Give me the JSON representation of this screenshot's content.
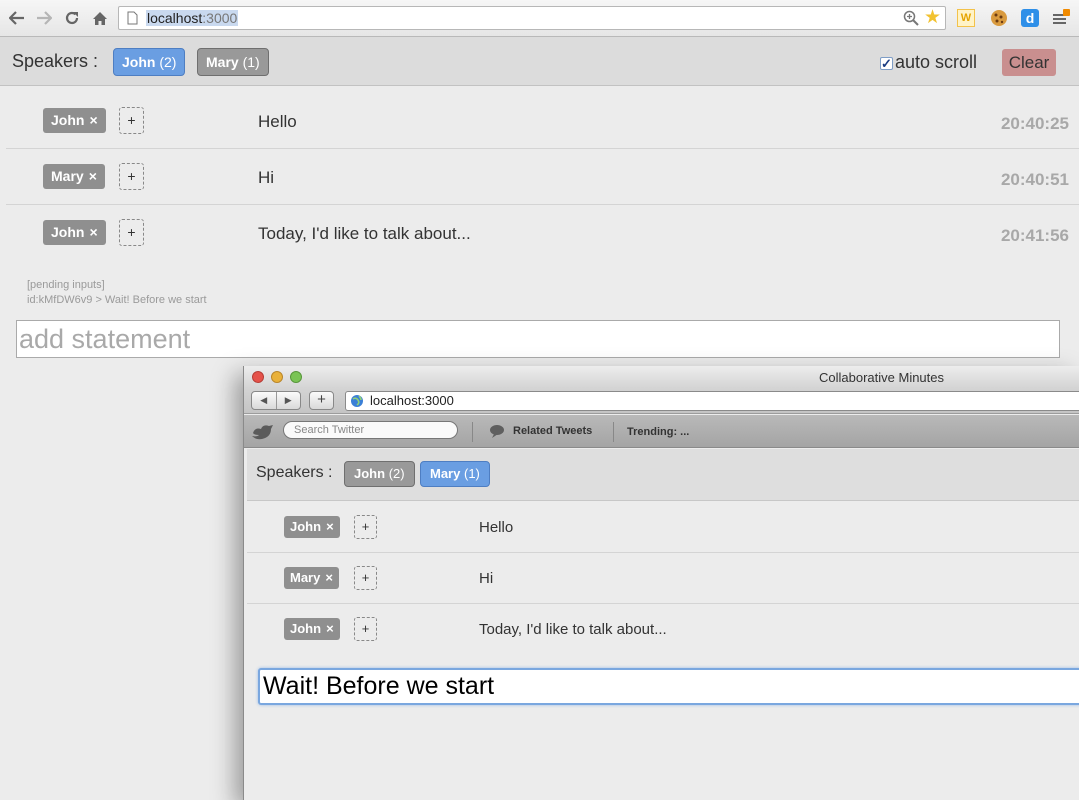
{
  "browser": {
    "url_host": "localhost",
    "url_port": ":3000"
  },
  "app": {
    "speakers_label": "Speakers :",
    "speakers": [
      {
        "name": "John",
        "count": "(2)",
        "active": true
      },
      {
        "name": "Mary",
        "count": "(1)",
        "active": false
      }
    ],
    "auto_scroll_label": "auto scroll",
    "auto_scroll_checked": true,
    "clear_label": "Clear",
    "statements": [
      {
        "speaker": "John",
        "remove": "×",
        "add": "+",
        "text": "Hello",
        "time": "20:40:25"
      },
      {
        "speaker": "Mary",
        "remove": "×",
        "add": "+",
        "text": "Hi",
        "time": "20:40:51"
      },
      {
        "speaker": "John",
        "remove": "×",
        "add": "+",
        "text": "Today, I'd like to talk about...",
        "time": "20:41:56"
      }
    ],
    "pending_title": "[pending inputs]",
    "pending_line": "id:kMfDW6v9 > Wait! Before we start",
    "input_placeholder": "add statement"
  },
  "safari": {
    "title": "Collaborative Minutes",
    "address": "localhost:3000",
    "search_placeholder": "Search Twitter",
    "related_tweets": "Related Tweets",
    "trending": "Trending: ...",
    "speakers_label": "Speakers :",
    "speakers": [
      {
        "name": "John",
        "count": "(2)",
        "active": false
      },
      {
        "name": "Mary",
        "count": "(1)",
        "active": true
      }
    ],
    "statements": [
      {
        "speaker": "John",
        "remove": "×",
        "add": "+",
        "text": "Hello"
      },
      {
        "speaker": "Mary",
        "remove": "×",
        "add": "+",
        "text": "Hi"
      },
      {
        "speaker": "John",
        "remove": "×",
        "add": "+",
        "text": "Today, I'd like to talk about..."
      }
    ],
    "input_value": "Wait! Before we start"
  },
  "colors": {
    "active_speaker": "#6a9ee2",
    "inactive_speaker": "#999999",
    "clear_button": "#c98f8f",
    "tag": "#8f8f8f"
  }
}
